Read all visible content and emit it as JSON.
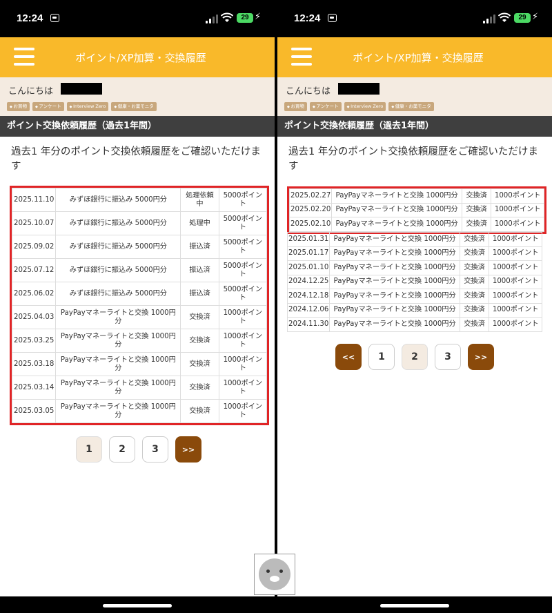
{
  "status": {
    "time": "12:24",
    "battery": "29"
  },
  "header": {
    "title": "ポイント/XP加算・交換履歴"
  },
  "greeting": {
    "text": "こんにちは"
  },
  "tags": [
    "お買物",
    "アンケート",
    "Interview Zero",
    "健康・お薬モニタ"
  ],
  "section": {
    "title": "ポイント交換依頼履歴（過去1年間）"
  },
  "intro": "過去1 年分のポイント交換依頼履歴をご確認いただけます",
  "left_table": [
    {
      "date": "2025.11.10",
      "item": "みずほ銀行に振込み 5000円分",
      "status": "処理依頼中",
      "points": "5000ポイント"
    },
    {
      "date": "2025.10.07",
      "item": "みずほ銀行に振込み 5000円分",
      "status": "処理中",
      "points": "5000ポイント"
    },
    {
      "date": "2025.09.02",
      "item": "みずほ銀行に振込み 5000円分",
      "status": "振込済",
      "points": "5000ポイント"
    },
    {
      "date": "2025.07.12",
      "item": "みずほ銀行に振込み 5000円分",
      "status": "振込済",
      "points": "5000ポイント"
    },
    {
      "date": "2025.06.02",
      "item": "みずほ銀行に振込み 5000円分",
      "status": "振込済",
      "points": "5000ポイント"
    },
    {
      "date": "2025.04.03",
      "item": "PayPayマネーライトと交換 1000円分",
      "status": "交換済",
      "points": "1000ポイント"
    },
    {
      "date": "2025.03.25",
      "item": "PayPayマネーライトと交換 1000円分",
      "status": "交換済",
      "points": "1000ポイント"
    },
    {
      "date": "2025.03.18",
      "item": "PayPayマネーライトと交換 1000円分",
      "status": "交換済",
      "points": "1000ポイント"
    },
    {
      "date": "2025.03.14",
      "item": "PayPayマネーライトと交換 1000円分",
      "status": "交換済",
      "points": "1000ポイント"
    },
    {
      "date": "2025.03.05",
      "item": "PayPayマネーライトと交換 1000円分",
      "status": "交換済",
      "points": "1000ポイント"
    }
  ],
  "right_table_highlighted": [
    {
      "date": "2025.02.27",
      "item": "PayPayマネーライトと交換 1000円分",
      "status": "交換済",
      "points": "1000ポイント"
    },
    {
      "date": "2025.02.20",
      "item": "PayPayマネーライトと交換 1000円分",
      "status": "交換済",
      "points": "1000ポイント"
    },
    {
      "date": "2025.02.10",
      "item": "PayPayマネーライトと交換 1000円分",
      "status": "交換済",
      "points": "1000ポイント"
    }
  ],
  "right_table_rest": [
    {
      "date": "2025.01.31",
      "item": "PayPayマネーライトと交換 1000円分",
      "status": "交換済",
      "points": "1000ポイント"
    },
    {
      "date": "2025.01.17",
      "item": "PayPayマネーライトと交換 1000円分",
      "status": "交換済",
      "points": "1000ポイント"
    },
    {
      "date": "2025.01.10",
      "item": "PayPayマネーライトと交換 1000円分",
      "status": "交換済",
      "points": "1000ポイント"
    },
    {
      "date": "2024.12.25",
      "item": "PayPayマネーライトと交換 1000円分",
      "status": "交換済",
      "points": "1000ポイント"
    },
    {
      "date": "2024.12.18",
      "item": "PayPayマネーライトと交換 1000円分",
      "status": "交換済",
      "points": "1000ポイント"
    },
    {
      "date": "2024.12.06",
      "item": "PayPayマネーライトと交換 1000円分",
      "status": "交換済",
      "points": "1000ポイント"
    },
    {
      "date": "2024.11.30",
      "item": "PayPayマネーライトと交換 1000円分",
      "status": "交換済",
      "points": "1000ポイント"
    }
  ],
  "pager_left": {
    "pages": [
      "1",
      "2",
      "3"
    ],
    "next": ">>"
  },
  "pager_right": {
    "prev": "<<",
    "pages": [
      "1",
      "2",
      "3"
    ],
    "next": ">>"
  },
  "colors": {
    "header": "#f9b92a",
    "highlight": "#e02426",
    "pager_arrow": "#8a4a0b"
  }
}
